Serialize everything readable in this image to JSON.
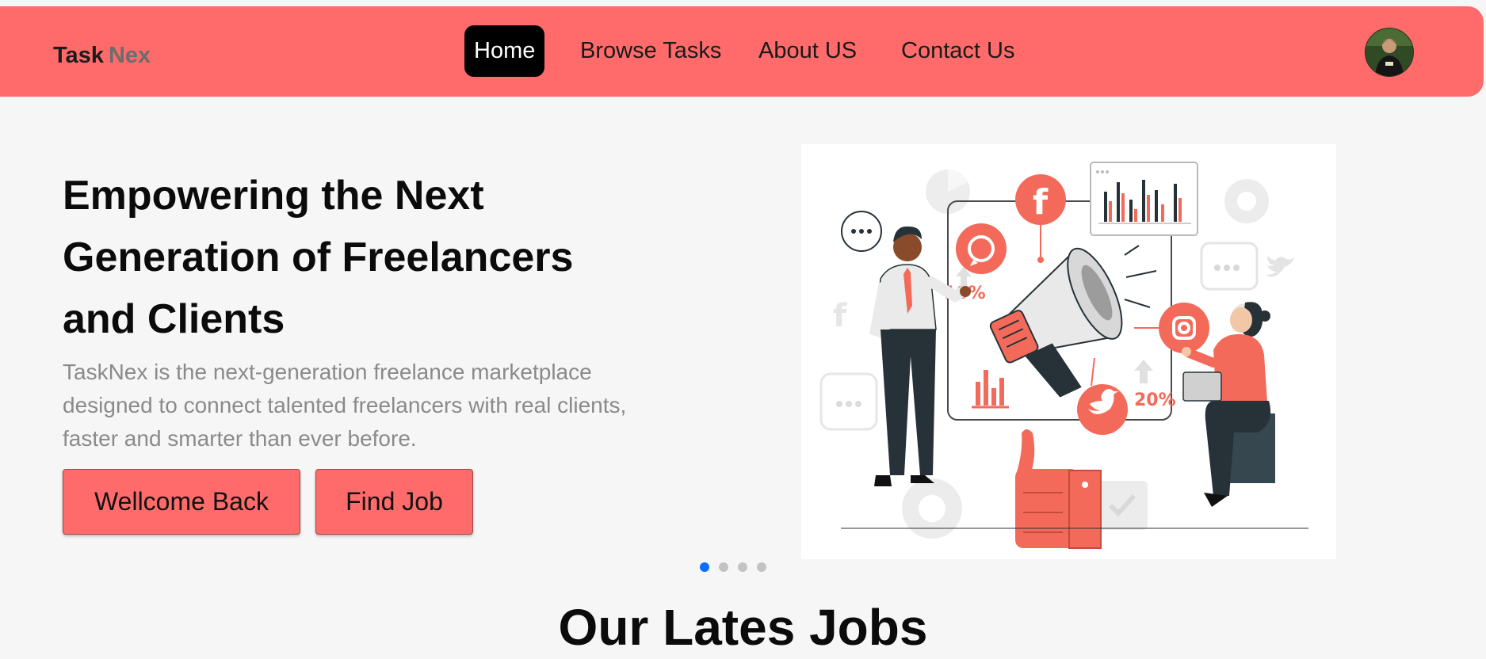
{
  "navbar": {
    "brand_part1": "Task",
    "brand_part2": "Nex",
    "links": [
      "Home",
      "Browse Tasks",
      "About US",
      "Contact Us"
    ],
    "active_link": "Home",
    "avatar_icon": "user-avatar-photo"
  },
  "hero": {
    "title": "Empowering the Next Generation of Freelancers and Clients",
    "description": "TaskNex is the next-generation freelance marketplace designed to connect talented freelancers with real clients, faster and smarter than ever before.",
    "primary_button": "Wellcome Back",
    "secondary_button": "Find Job",
    "illustration": {
      "name": "social-media-marketing-illustration",
      "percent_labels": [
        "10%",
        "20%"
      ],
      "icons": [
        "facebook-icon",
        "whatsapp-icon",
        "instagram-icon",
        "twitter-icon",
        "megaphone-icon",
        "thumbs-up-icon",
        "laptop-icon"
      ]
    }
  },
  "carousel": {
    "slides": 4,
    "active_index": 0
  },
  "latest_jobs": {
    "title": "Our Lates Jobs"
  },
  "colors": {
    "brand": "#ff6b6b",
    "active_dot": "#0d6efd",
    "active_nav_bg": "#000000"
  }
}
